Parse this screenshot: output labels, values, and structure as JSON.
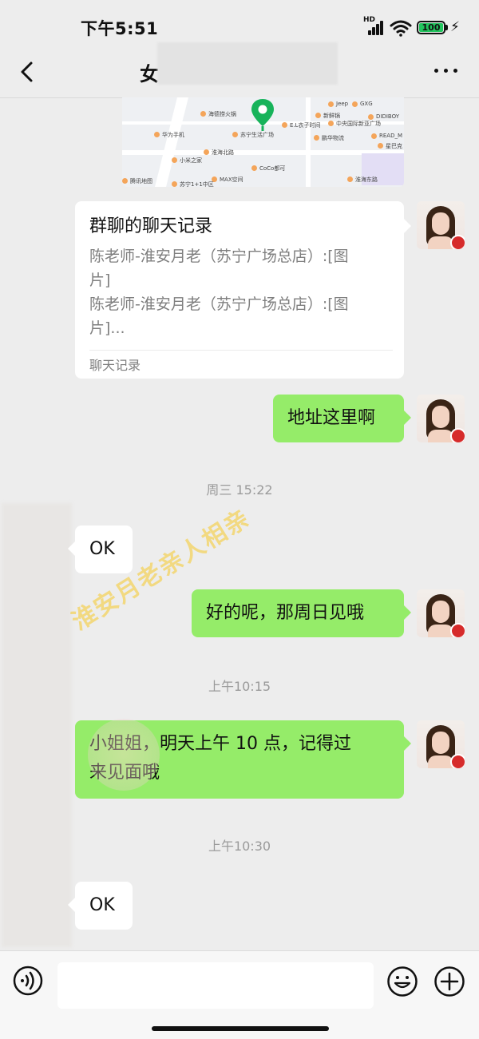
{
  "status_bar": {
    "time": "下午5:51",
    "network": "HD",
    "battery": "100"
  },
  "nav": {
    "title": "女"
  },
  "map": {
    "pois": [
      "海德捞火锅",
      "苏宁生活广场",
      "E.L衣子时间",
      "新鲜锅",
      "Jeep",
      "GXG",
      "华为手机",
      "小米之家",
      "MAX空间",
      "CoCo都可",
      "苏宁1+1中区",
      "鹏华物流",
      "淮海北路",
      "淮海东路",
      "DIDIBOY",
      "READ_M",
      "星巴克",
      "中央国际新亚广场",
      "腾讯地图"
    ]
  },
  "card": {
    "title": "群聊的聊天记录",
    "line1a": "陈老师-淮安月老（苏宁广场总店）:[图",
    "line1b": "片]",
    "line2a": "陈老师-淮安月老（苏宁广场总店）:[图",
    "line2b": "片]...",
    "footer": "聊天记录"
  },
  "messages": {
    "m1": "地址这里啊",
    "m2": "OK",
    "m3": "好的呢，那周日见哦",
    "m4a": "小姐姐，明天上午 10 点，记得过",
    "m4b": "来见面哦",
    "m5": "OK"
  },
  "timestamps": {
    "t1": "周三 15:22",
    "t2": "上午10:15",
    "t3": "上午10:30"
  },
  "watermark": "淮安月老亲人相亲",
  "input": {
    "value": ""
  }
}
